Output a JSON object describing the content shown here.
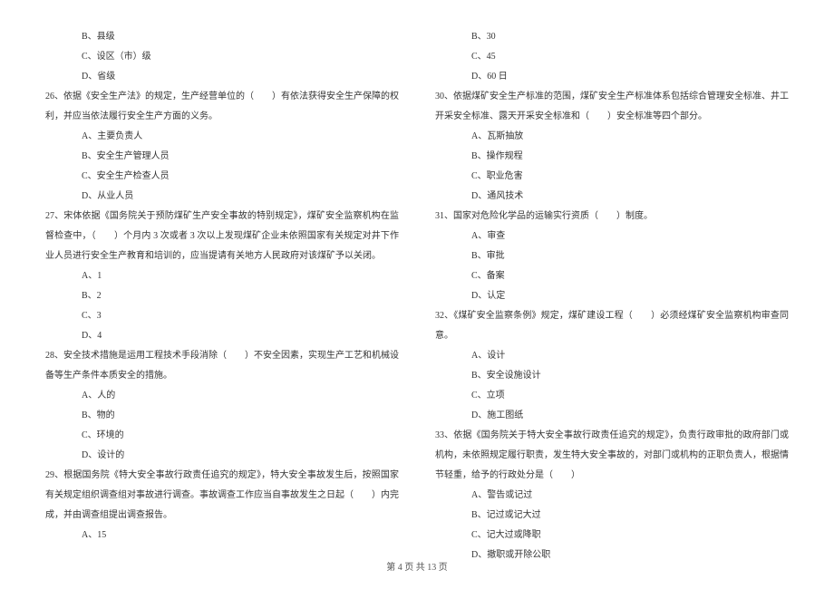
{
  "left": {
    "opt_b_25": "B、县级",
    "opt_c_25": "C、设区（市）级",
    "opt_d_25": "D、省级",
    "q26": "26、依据《安全生产法》的规定，生产经营单位的（　　）有依法获得安全生产保障的权利，并应当依法履行安全生产方面的义务。",
    "opt_a_26": "A、主要负责人",
    "opt_b_26": "B、安全生产管理人员",
    "opt_c_26": "C、安全生产检查人员",
    "opt_d_26": "D、从业人员",
    "q27": "27、宋体依据《国务院关于预防煤矿生产安全事故的特别规定》，煤矿安全监察机构在监督检查中，（　　）个月内 3 次或者 3 次以上发现煤矿企业未依照国家有关规定对井下作业人员进行安全生产教育和培训的，应当提请有关地方人民政府对该煤矿予以关闭。",
    "opt_a_27": "A、1",
    "opt_b_27": "B、2",
    "opt_c_27": "C、3",
    "opt_d_27": "D、4",
    "q28": "28、安全技术措施是运用工程技术手段消除（　　）不安全因素，实现生产工艺和机械设备等生产条件本质安全的措施。",
    "opt_a_28": "A、人的",
    "opt_b_28": "B、物的",
    "opt_c_28": "C、环境的",
    "opt_d_28": "D、设计的",
    "q29": "29、根据国务院《特大安全事故行政责任追究的规定》，特大安全事故发生后，按照国家有关规定组织调查组对事故进行调查。事故调查工作应当自事故发生之日起（　　）内完成，并由调查组提出调查报告。",
    "opt_a_29": "A、15"
  },
  "right": {
    "opt_b_29": "B、30",
    "opt_c_29": "C、45",
    "opt_d_29": "D、60 日",
    "q30": "30、依据煤矿安全生产标准的范围，煤矿安全生产标准体系包括综合管理安全标准、井工开采安全标准、露天开采安全标准和（　　）安全标准等四个部分。",
    "opt_a_30": "A、瓦斯抽放",
    "opt_b_30": "B、操作规程",
    "opt_c_30": "C、职业危害",
    "opt_d_30": "D、通风技术",
    "q31": "31、国家对危险化学品的运输实行资质（　　）制度。",
    "opt_a_31": "A、审查",
    "opt_b_31": "B、审批",
    "opt_c_31": "C、备案",
    "opt_d_31": "D、认定",
    "q32": "32、《煤矿安全监察条例》规定，煤矿建设工程（　　）必须经煤矿安全监察机构审查同意。",
    "opt_a_32": "A、设计",
    "opt_b_32": "B、安全设施设计",
    "opt_c_32": "C、立项",
    "opt_d_32": "D、施工图纸",
    "q33": "33、依据《国务院关于特大安全事故行政责任追究的规定》，负责行政审批的政府部门或机构，未依照规定履行职责，发生特大安全事故的，对部门或机构的正职负责人，根据情节轻重，给予的行政处分是（　　）",
    "opt_a_33": "A、警告或记过",
    "opt_b_33": "B、记过或记大过",
    "opt_c_33": "C、记大过或降职",
    "opt_d_33": "D、撤职或开除公职"
  },
  "footer": "第 4 页 共 13 页"
}
